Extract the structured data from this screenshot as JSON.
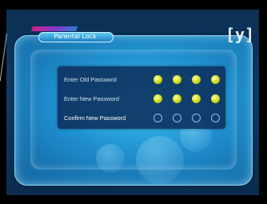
{
  "window": {
    "title": "Parental Lock",
    "tag_text": "",
    "logo_text": "[y]"
  },
  "form": {
    "fields": [
      {
        "label": "Enter Old Password",
        "filled": 4,
        "total": 4,
        "focused": false
      },
      {
        "label": "Enter New Password",
        "filled": 4,
        "total": 4,
        "focused": false
      },
      {
        "label": "Confirm New Password",
        "filled": 0,
        "total": 4,
        "focused": true
      }
    ]
  },
  "colors": {
    "background": "#0b2f52",
    "frame": "#1d88c4",
    "panel": "#0c305c",
    "dot_filled": "#d6e12a",
    "dot_empty_border": "#8fc3e6",
    "text": "#ffffff"
  },
  "icons": {
    "logo": "channel-logo-icon",
    "filled_dot": "filled-digit-dot-icon",
    "empty_dot": "empty-digit-dot-icon"
  }
}
